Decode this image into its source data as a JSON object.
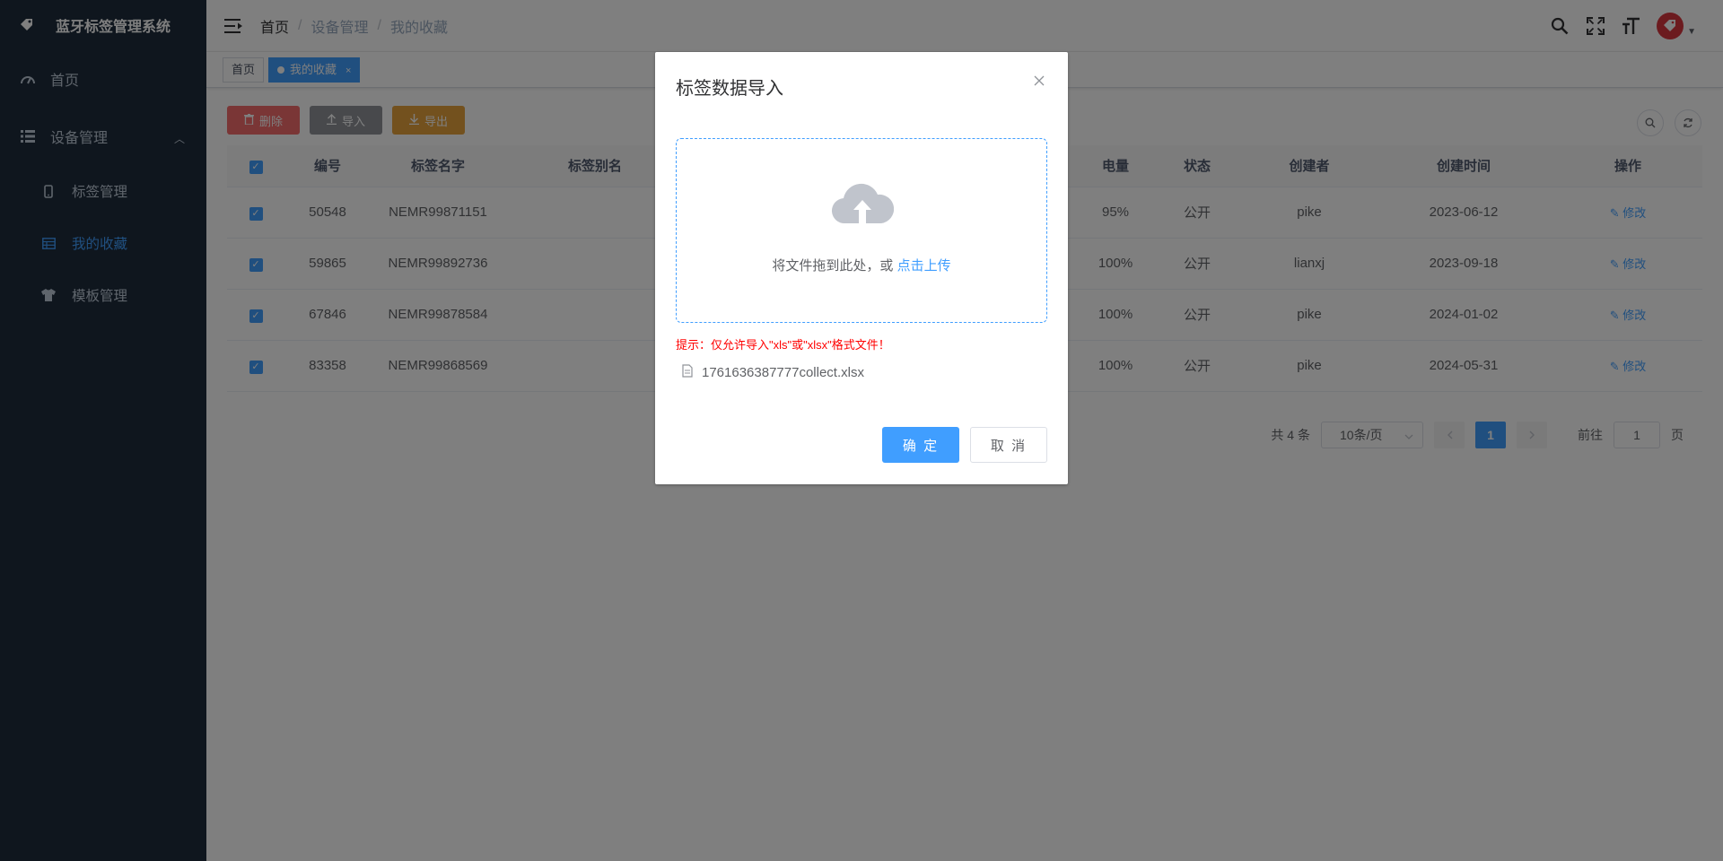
{
  "sidebar": {
    "title": "蓝牙标签管理系统",
    "home": "首页",
    "device": "设备管理",
    "items": [
      {
        "label": "标签管理"
      },
      {
        "label": "我的收藏"
      },
      {
        "label": "模板管理"
      }
    ]
  },
  "breadcrumb": {
    "home": "首页",
    "device": "设备管理",
    "current": "我的收藏",
    "sep": "/"
  },
  "tags": {
    "home": "首页",
    "active": "我的收藏",
    "close": "×"
  },
  "toolbar": {
    "delete": "删除",
    "import": "导入",
    "export": "导出"
  },
  "table": {
    "headers": [
      "编号",
      "标签名字",
      "标签别名",
      "电量",
      "状态",
      "创建者",
      "创建时间",
      "操作"
    ],
    "rows": [
      {
        "id": "50548",
        "name": "NEMR99871151",
        "battery": "95%",
        "status": "公开",
        "creator": "pike",
        "date": "2023-06-12",
        "action": "修改"
      },
      {
        "id": "59865",
        "name": "NEMR99892736",
        "battery": "100%",
        "status": "公开",
        "creator": "lianxj",
        "date": "2023-09-18",
        "action": "修改"
      },
      {
        "id": "67846",
        "name": "NEMR99878584",
        "battery": "100%",
        "status": "公开",
        "creator": "pike",
        "date": "2024-01-02",
        "action": "修改"
      },
      {
        "id": "83358",
        "name": "NEMR99868569",
        "battery": "100%",
        "status": "公开",
        "creator": "pike",
        "date": "2024-05-31",
        "action": "修改"
      }
    ]
  },
  "pagination": {
    "total": "共 4 条",
    "page_size": "10条/页",
    "current": "1",
    "goto_prefix": "前往",
    "goto_value": "1",
    "goto_suffix": "页"
  },
  "dialog": {
    "title": "标签数据导入",
    "drop_text": "将文件拖到此处，或",
    "click_upload": "点击上传",
    "tip": "提示：仅允许导入\"xls\"或\"xlsx\"格式文件！",
    "file_name": "1761636387777collect.xlsx",
    "confirm": "确 定",
    "cancel": "取 消"
  },
  "colors": {
    "primary": "#409eff",
    "sidebar": "#1f2d3d",
    "danger": "#f56c6c",
    "warning": "#e6a23c",
    "info": "#909399"
  }
}
